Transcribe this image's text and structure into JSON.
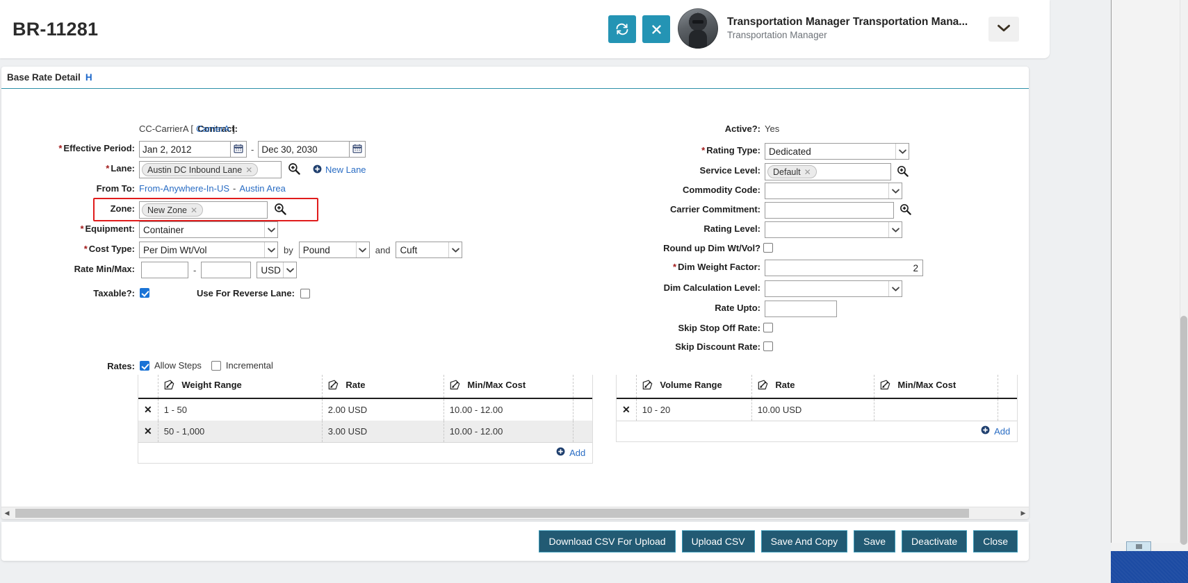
{
  "header": {
    "record_id": "BR-11281",
    "refresh_icon": "refresh-icon",
    "close_icon": "close-x-icon",
    "user_name": "Transportation Manager Transportation Mana...",
    "user_role": "Transportation Manager",
    "caret_icon": "chevron-down-icon",
    "accent_color": "#2494b4"
  },
  "panel": {
    "title": "Base Rate Detail",
    "help_link": "H"
  },
  "left": {
    "contract_label": "Contract:",
    "contract_value": "CC-CarrierA [",
    "contract_link": "CarrierA",
    "contract_value_end": "]",
    "effective_label": "Effective Period:",
    "effective_from": "Jan 2, 2012",
    "effective_sep": "-",
    "effective_to": "Dec 30, 2030",
    "lane_label": "Lane:",
    "lane_chip": "Austin DC Inbound Lane",
    "new_lane_label": "New Lane",
    "fromto_label": "From To:",
    "fromto_from": "From-Anywhere-In-US",
    "fromto_sep": "-",
    "fromto_to": "Austin Area",
    "zone_label": "Zone:",
    "zone_chip": "New Zone",
    "zone_highlight_color": "#e01b1b",
    "equipment_label": "Equipment:",
    "equipment_value": "Container",
    "cost_type_label": "Cost Type:",
    "cost_type_value": "Per Dim Wt/Vol",
    "cost_type_by": "by",
    "cost_type_unit1": "Pound",
    "cost_type_and": "and",
    "cost_type_unit2": "Cuft",
    "rate_minmax_label": "Rate Min/Max:",
    "rate_min": "",
    "rate_minmax_sep": "-",
    "rate_max": "",
    "rate_currency": "USD",
    "taxable_label": "Taxable?:",
    "taxable_checked": true,
    "reverse_lane_label": "Use For Reverse Lane:",
    "reverse_lane_checked": false
  },
  "right": {
    "active_label": "Active?:",
    "active_value": "Yes",
    "rating_type_label": "Rating Type:",
    "rating_type_value": "Dedicated",
    "service_level_label": "Service Level:",
    "service_level_chip": "Default",
    "commodity_code_label": "Commodity Code:",
    "commodity_code_value": "",
    "carrier_commitment_label": "Carrier Commitment:",
    "carrier_commitment_value": "",
    "rating_level_label": "Rating Level:",
    "rating_level_value": "",
    "round_up_label": "Round up Dim Wt/Vol?",
    "round_up_checked": false,
    "dim_weight_factor_label": "Dim Weight Factor:",
    "dim_weight_factor_value": "2",
    "dim_calc_level_label": "Dim Calculation Level:",
    "dim_calc_level_value": "",
    "rate_upto_label": "Rate Upto:",
    "rate_upto_value": "",
    "skip_stop_off_label": "Skip Stop Off Rate:",
    "skip_stop_off_checked": false,
    "skip_discount_label": "Skip Discount Rate:",
    "skip_discount_checked": false
  },
  "rates": {
    "label": "Rates:",
    "allow_steps_label": "Allow Steps",
    "allow_steps_checked": true,
    "incremental_label": "Incremental",
    "incremental_checked": false,
    "weight_table": {
      "columns": [
        "Weight Range",
        "Rate",
        "Min/Max Cost"
      ],
      "rows": [
        [
          "1 - 50",
          "2.00 USD",
          "10.00 - 12.00"
        ],
        [
          "50 - 1,000",
          "3.00 USD",
          "10.00 - 12.00"
        ]
      ],
      "add_label": "Add"
    },
    "volume_table": {
      "columns": [
        "Volume Range",
        "Rate",
        "Min/Max Cost"
      ],
      "rows": [
        [
          "10 - 20",
          "10.00 USD",
          ""
        ]
      ],
      "add_label": "Add"
    }
  },
  "footer": {
    "buttons": [
      "Download CSV For Upload",
      "Upload CSV",
      "Save And Copy",
      "Save",
      "Deactivate",
      "Close"
    ],
    "button_color": "#225a73"
  }
}
